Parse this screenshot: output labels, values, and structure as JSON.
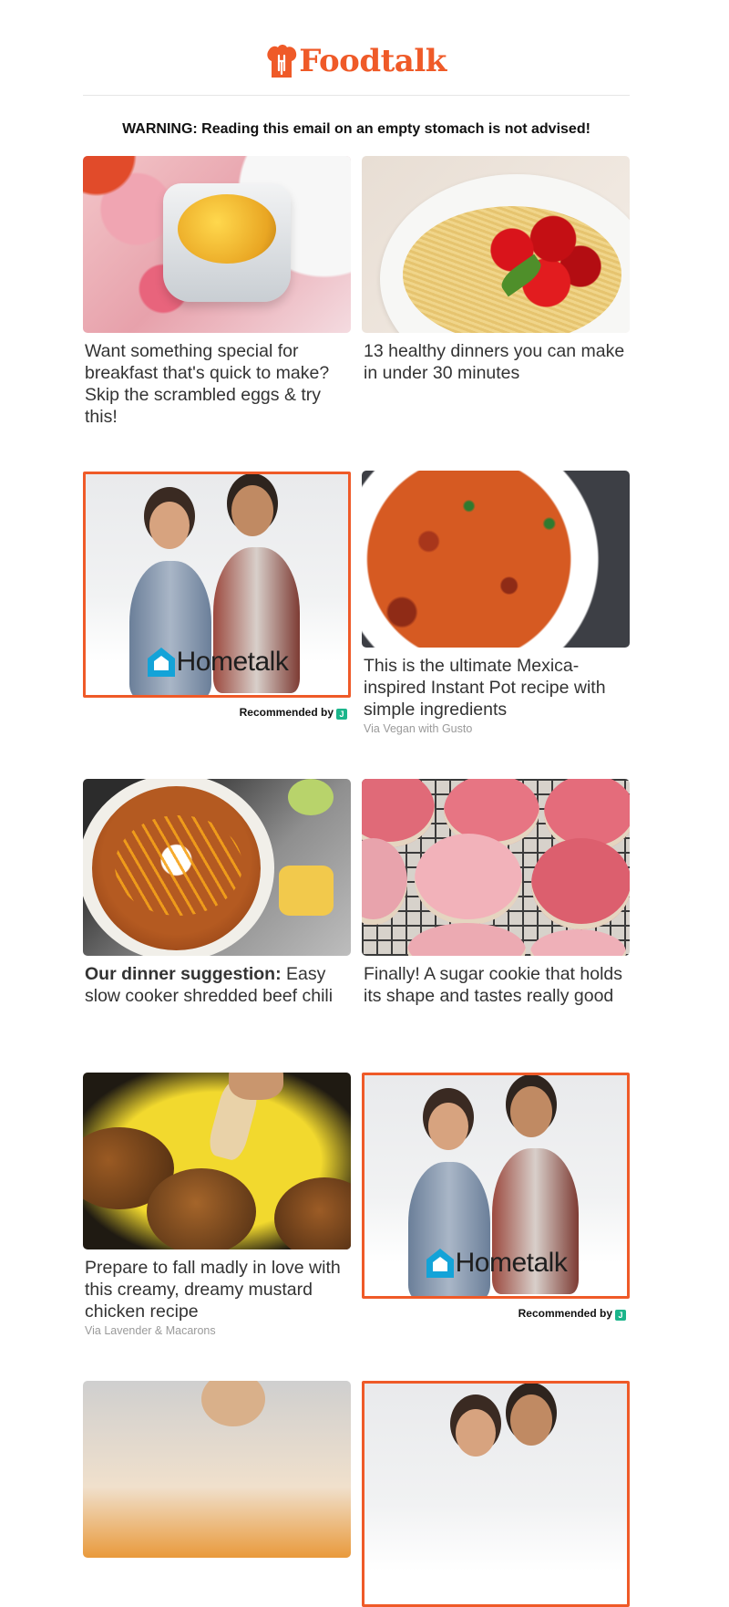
{
  "header": {
    "brand": "Foodtalk",
    "brand_color": "#ef5a28",
    "logo_icon": "chef-hat-fork-icon"
  },
  "warning": "WARNING: Reading this email on an empty stomach is not advised!",
  "cards": [
    {
      "title": "Want something special for breakfast that's quick to make? Skip the scrambled eggs & try this!",
      "image": "ramekin-eggs"
    },
    {
      "title": "13 healthy dinners you can make in under 30 minutes",
      "image": "spaghetti-tomatoes"
    },
    {
      "title": "This is the ultimate Mexica-inspired Instant Pot recipe with simple ingredients",
      "via": "Via Vegan with Gusto",
      "image": "mexican-rice"
    },
    {
      "title_bold": "Our dinner suggestion:",
      "title": " Easy slow cooker shredded beef chili",
      "image": "beef-chili"
    },
    {
      "title": "Finally! A sugar cookie that holds its shape and tastes really good",
      "image": "pink-sugar-cookies"
    },
    {
      "title": "Prepare to fall madly in love with this creamy, dreamy mustard chicken recipe",
      "via": "Via Lavender & Macarons",
      "image": "mustard-chicken"
    }
  ],
  "ads": {
    "brand": "Hometalk",
    "brand_icon": "house-icon",
    "recommended_label": "Recommended by",
    "badge": "J",
    "accent_color": "#ef5a28"
  }
}
